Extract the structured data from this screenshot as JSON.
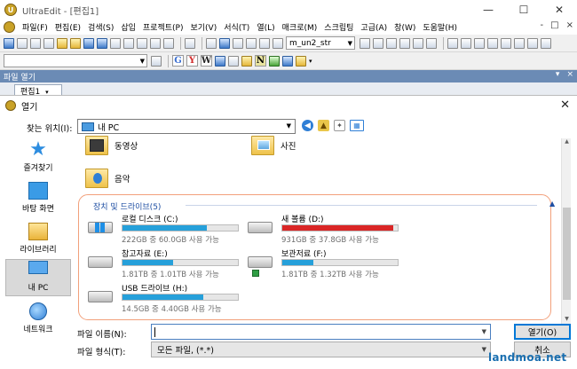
{
  "app": {
    "title": "UltraEdit - [편집1]",
    "window_buttons": [
      "—",
      "☐",
      "✕"
    ]
  },
  "menubar": {
    "items": [
      "파일(F)",
      "편집(E)",
      "검색(S)",
      "삽입",
      "프로젝트(P)",
      "보기(V)",
      "서식(T)",
      "열(L)",
      "매크로(M)",
      "스크립팅",
      "고급(A)",
      "창(W)",
      "도움말(H)"
    ],
    "right_controls": [
      "-",
      "□",
      "×"
    ]
  },
  "toolbar": {
    "find_combo_value": "m_un2_str",
    "font_combo_value": "",
    "letters": [
      "G",
      "Y",
      "W",
      "N"
    ]
  },
  "panel": {
    "title": "파일 열기",
    "controls": [
      "▾",
      "×"
    ],
    "tab_label": "편집1"
  },
  "dialog": {
    "title": "열기",
    "close_glyph": "✕",
    "look_in_label": "찾는 위치(I):",
    "look_in_value": "내 PC",
    "places": [
      {
        "label": "즐겨찾기",
        "icon": "star-icon"
      },
      {
        "label": "바탕 화면",
        "icon": "desktop-icon"
      },
      {
        "label": "라이브러리",
        "icon": "library-icon"
      },
      {
        "label": "내 PC",
        "icon": "computer-icon",
        "selected": true
      },
      {
        "label": "네트워크",
        "icon": "network-icon"
      }
    ],
    "folders": [
      {
        "name": "동영상",
        "icon": "videos-folder-icon"
      },
      {
        "name": "사진",
        "icon": "pictures-folder-icon"
      },
      {
        "name": "음악",
        "icon": "music-folder-icon"
      }
    ],
    "drives_group_title": "장치 및 드라이브(5)",
    "drives": [
      {
        "name": "로컬 디스크 (C:)",
        "free_text": "222GB 중 60.0GB 사용 가능",
        "used_fraction": 0.73,
        "full": false,
        "icon": "system-drive-icon"
      },
      {
        "name": "새 볼륨 (D:)",
        "free_text": "931GB 중 37.8GB 사용 가능",
        "used_fraction": 0.96,
        "full": true,
        "icon": "hard-drive-icon"
      },
      {
        "name": "참고자료 (E:)",
        "free_text": "1.81TB 중 1.01TB 사용 가능",
        "used_fraction": 0.44,
        "full": false,
        "icon": "hard-drive-icon"
      },
      {
        "name": "보관저료 (F:)",
        "free_text": "1.81TB 중 1.32TB 사용 가능",
        "used_fraction": 0.27,
        "full": false,
        "icon": "external-drive-icon"
      },
      {
        "name": "USB 드라이브 (H:)",
        "free_text": "14.5GB 중 4.40GB 사용 가능",
        "used_fraction": 0.7,
        "full": false,
        "icon": "usb-drive-icon"
      }
    ],
    "file_name_label": "파일 이름(N):",
    "file_name_value": "",
    "file_type_label": "파일 형식(T):",
    "file_type_value": "모든 파일, (*.*)",
    "open_button": "열기(O)",
    "cancel_button": "취소"
  },
  "watermark": "landmoa.net",
  "colors": {
    "drive_bar": "#26a0da",
    "drive_bar_full": "#da2626",
    "group_border": "#f2a07b",
    "group_title": "#1f4fa3",
    "watermark": "#1a6fb0"
  }
}
